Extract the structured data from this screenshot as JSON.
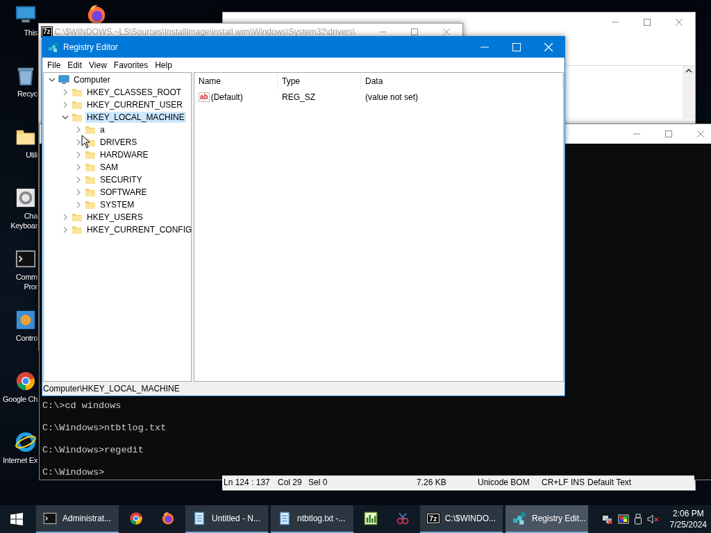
{
  "desktop_icons": [
    {
      "kind": "computer",
      "label_lines": [
        "This"
      ]
    },
    {
      "kind": "recycle",
      "label_lines": [
        "Recyc"
      ]
    },
    {
      "kind": "folder",
      "label_lines": [
        "Utili"
      ]
    },
    {
      "kind": "gear",
      "label_lines": [
        "Cha",
        "Keyboar"
      ]
    },
    {
      "kind": "console",
      "label_lines": [
        "Comm",
        "Pror"
      ]
    },
    {
      "kind": "control",
      "label_lines": [
        "Contro"
      ]
    },
    {
      "kind": "chrome",
      "label_lines": [
        "Google Ch"
      ]
    },
    {
      "kind": "ie",
      "label_lines": [
        "Internet Ex"
      ]
    }
  ],
  "notepad_window": {
    "status_bar": [
      "Ln 124 : 137",
      "Col 29",
      "Sel 0",
      "7.26 KB",
      "Unicode BOM",
      "CR+LF",
      "INS",
      "Default Text"
    ]
  },
  "archive_window": {
    "logo": "7z",
    "title": "C:\\$WINDOWS.~LS\\Sources\\InstallImage\\install.wim\\Windows\\System32\\drivers\\"
  },
  "console_window": {
    "lines": [
      "C:\\>cd windows",
      "C:\\Windows>ntbtlog.txt",
      "C:\\Windows>regedit",
      "C:\\Windows>"
    ]
  },
  "registry_window": {
    "title": "Registry Editor",
    "menu": [
      "File",
      "Edit",
      "View",
      "Favorites",
      "Help"
    ],
    "tree": [
      {
        "label": "Computer",
        "kind": "computer",
        "expanded": true,
        "selected": false,
        "children": [
          {
            "label": "HKEY_CLASSES_ROOT",
            "kind": "folder",
            "expanded": false,
            "selected": false
          },
          {
            "label": "HKEY_CURRENT_USER",
            "kind": "folder",
            "expanded": false,
            "selected": false
          },
          {
            "label": "HKEY_LOCAL_MACHINE",
            "kind": "folder",
            "expanded": true,
            "selected": true,
            "children": [
              {
                "label": "a",
                "kind": "folder",
                "expanded": false,
                "selected": false
              },
              {
                "label": "DRIVERS",
                "kind": "folder",
                "expanded": false,
                "selected": false
              },
              {
                "label": "HARDWARE",
                "kind": "folder",
                "expanded": false,
                "selected": false
              },
              {
                "label": "SAM",
                "kind": "folder",
                "expanded": false,
                "selected": false
              },
              {
                "label": "SECURITY",
                "kind": "folder",
                "expanded": false,
                "selected": false
              },
              {
                "label": "SOFTWARE",
                "kind": "folder",
                "expanded": false,
                "selected": false
              },
              {
                "label": "SYSTEM",
                "kind": "folder",
                "expanded": false,
                "selected": false
              }
            ]
          },
          {
            "label": "HKEY_USERS",
            "kind": "folder",
            "expanded": false,
            "selected": false
          },
          {
            "label": "HKEY_CURRENT_CONFIG",
            "kind": "folder",
            "expanded": false,
            "selected": false
          }
        ]
      }
    ],
    "columns": [
      "Name",
      "Type",
      "Data"
    ],
    "rows": [
      {
        "icon_text": "ab",
        "name": "(Default)",
        "type": "REG_SZ",
        "data": "(value not set)"
      }
    ],
    "status_bar": "Computer\\HKEY_LOCAL_MACHINE"
  },
  "taskbar": {
    "items": [
      {
        "kind": "console",
        "label": "Administrat...",
        "selected": false
      },
      {
        "kind": "chrome",
        "selected": false
      },
      {
        "kind": "firefox",
        "selected": false
      },
      {
        "kind": "notepad",
        "label": "Untitled - N...",
        "selected": false
      },
      {
        "kind": "notepad",
        "label": "ntbtlog.txt -...",
        "selected": false
      },
      {
        "kind": "chart",
        "selected": false
      },
      {
        "kind": "scissors",
        "selected": false
      },
      {
        "kind": "sevenzip",
        "logo": "7z",
        "label": "C:\\$WINDO...",
        "selected": false
      },
      {
        "kind": "regedit",
        "label": "Registry Edit...",
        "selected": true
      }
    ],
    "time": "2:06 PM",
    "date": "7/25/2024"
  }
}
